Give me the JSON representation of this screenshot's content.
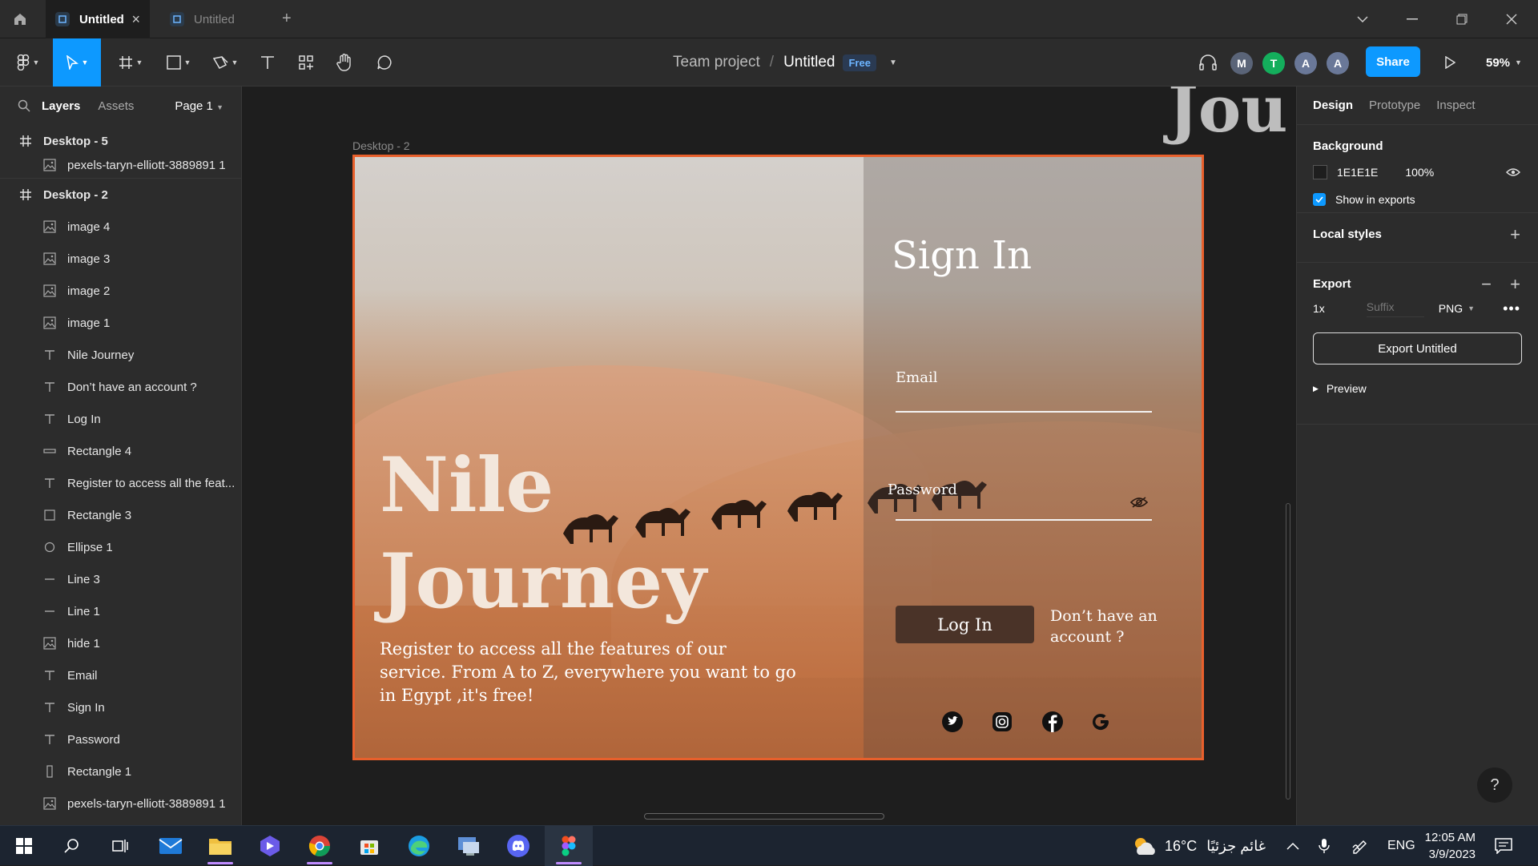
{
  "tabs": [
    {
      "label": "Untitled",
      "active": true
    },
    {
      "label": "Untitled",
      "active": false
    }
  ],
  "toolbar": {
    "project": "Team project",
    "separator": "/",
    "file": "Untitled",
    "plan_badge": "Free",
    "share_label": "Share",
    "zoom": "59%",
    "avatars": [
      {
        "letter": "M",
        "color": "#5a6478"
      },
      {
        "letter": "T",
        "color": "#14ae5c"
      },
      {
        "letter": "A",
        "color": "#6a7898"
      },
      {
        "letter": "A",
        "color": "#6a7898"
      }
    ]
  },
  "left_panel": {
    "tab_layers": "Layers",
    "tab_assets": "Assets",
    "page": "Page 1",
    "layers": [
      {
        "name": "Desktop - 5",
        "type": "frame"
      },
      {
        "name": "pexels-taryn-elliott-3889891 1",
        "type": "image"
      },
      {
        "name": "Desktop - 2",
        "type": "frame"
      },
      {
        "name": "image 4",
        "type": "image"
      },
      {
        "name": "image 3",
        "type": "image"
      },
      {
        "name": "image 2",
        "type": "image"
      },
      {
        "name": "image 1",
        "type": "image"
      },
      {
        "name": "Nile Journey",
        "type": "text"
      },
      {
        "name": "Don’t have an account ?",
        "type": "text"
      },
      {
        "name": "Log In",
        "type": "text"
      },
      {
        "name": "Rectangle 4",
        "type": "rect-thin"
      },
      {
        "name": "Register to access all the feat...",
        "type": "text"
      },
      {
        "name": "Rectangle 3",
        "type": "rect"
      },
      {
        "name": "Ellipse 1",
        "type": "ellipse"
      },
      {
        "name": "Line 3",
        "type": "line"
      },
      {
        "name": "Line 1",
        "type": "line"
      },
      {
        "name": "hide 1",
        "type": "image"
      },
      {
        "name": "Email",
        "type": "text"
      },
      {
        "name": "Sign In",
        "type": "text"
      },
      {
        "name": "Password",
        "type": "text"
      },
      {
        "name": "Rectangle 1",
        "type": "rect-tall"
      },
      {
        "name": "pexels-taryn-elliott-3889891 1",
        "type": "image"
      }
    ]
  },
  "canvas": {
    "frame_label": "Desktop - 2",
    "background_title": "Jou",
    "design": {
      "hero_line1": "Nile",
      "hero_line2": "Journey",
      "register_text": "Register to access all the features of our service. From A to Z, everywhere you want to go in Egypt ,it's free!",
      "sign_in": "Sign In",
      "email_label": "Email",
      "password_label": "Password",
      "login_button": "Log In",
      "no_account": "Don’t have an account ?",
      "social_icons": [
        "twitter-icon",
        "instagram-icon",
        "facebook-icon",
        "google-icon"
      ]
    }
  },
  "right_panel": {
    "tabs": [
      "Design",
      "Prototype",
      "Inspect"
    ],
    "background": {
      "title": "Background",
      "hex": "1E1E1E",
      "opacity": "100%",
      "show_in_exports": "Show in exports"
    },
    "local_styles": "Local styles",
    "export": {
      "title": "Export",
      "scale": "1x",
      "suffix_placeholder": "Suffix",
      "format": "PNG",
      "button": "Export Untitled",
      "preview": "Preview"
    },
    "help": "?"
  },
  "taskbar": {
    "temperature": "16°C",
    "weather": "غائم جزئيًا",
    "language": "ENG",
    "time": "12:05 AM",
    "date": "3/9/2023"
  },
  "colors": {
    "accent": "#0d99ff",
    "frame_border": "#e8602c",
    "button_brown": "#4a3328"
  }
}
